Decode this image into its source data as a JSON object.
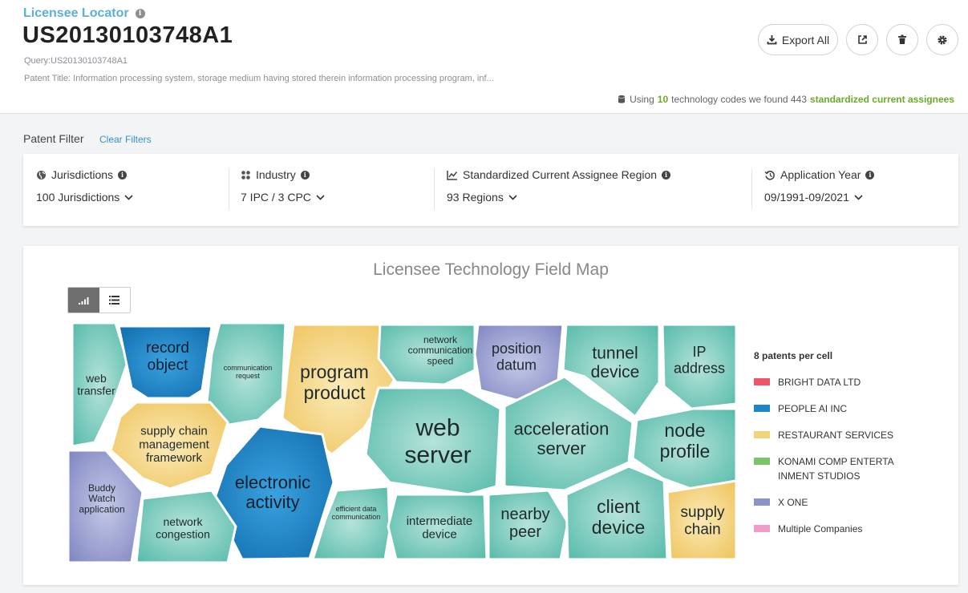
{
  "header": {
    "app_title": "Licensee Locator",
    "patent_number": "US20130103748A1",
    "query": "Query:US20130103748A1",
    "patent_title": "Patent Title: Information processing system, storage medium having stored therein information processing program, inf...",
    "export_label": "Export All",
    "summary": {
      "prefix": "Using",
      "codes": "10",
      "middle": "technology codes we found 443",
      "highlight": "standardized current assignees"
    }
  },
  "filters": {
    "label": "Patent Filter",
    "clear_label": "Clear Filters",
    "items": [
      {
        "name": "Jurisdictions",
        "value": "100 Jurisdictions"
      },
      {
        "name": "Industry",
        "value": "7 IPC / 3 CPC"
      },
      {
        "name": "Standardized Current Assignee Region",
        "value": "93 Regions"
      },
      {
        "name": "Application Year",
        "value": "09/1991-09/2021"
      }
    ]
  },
  "map": {
    "title": "Licensee Technology Field Map",
    "legend_header": "8 patents per cell",
    "legend": [
      {
        "name": "BRIGHT DATA LTD",
        "color": "#f0546a"
      },
      {
        "name": "PEOPLE AI INC",
        "color": "#1c86c8"
      },
      {
        "name": "RESTAURANT SERVICES",
        "color": "#f2d27a"
      },
      {
        "name": "KONAMI COMP ENTERTA INMENT STUDIOS",
        "color": "#7dc36a"
      },
      {
        "name": "X ONE",
        "color": "#8c93c9"
      },
      {
        "name": "Multiple Companies",
        "color": "#f29bc8"
      }
    ],
    "cells": [
      {
        "label": [
          "web",
          "transfer"
        ],
        "kind": "teal"
      },
      {
        "label": [
          "record",
          "object"
        ],
        "kind": "blue"
      },
      {
        "label": [
          "communication",
          "request"
        ],
        "kind": "teal"
      },
      {
        "label": [
          "program",
          "product"
        ],
        "kind": "yellow"
      },
      {
        "label": [
          "network",
          "communication",
          "speed"
        ],
        "kind": "teal"
      },
      {
        "label": [
          "position",
          "datum"
        ],
        "kind": "purple"
      },
      {
        "label": [
          "tunnel",
          "device"
        ],
        "kind": "teal"
      },
      {
        "label": [
          "IP",
          "address"
        ],
        "kind": "teal"
      },
      {
        "label": [
          "supply chain",
          "management",
          "framework"
        ],
        "kind": "yellow"
      },
      {
        "label": [
          "web",
          "server"
        ],
        "kind": "teal"
      },
      {
        "label": [
          "acceleration",
          "server"
        ],
        "kind": "teal"
      },
      {
        "label": [
          "node",
          "profile"
        ],
        "kind": "teal"
      },
      {
        "label": [
          "Buddy",
          "Watch",
          "application"
        ],
        "kind": "purple"
      },
      {
        "label": [
          "electronic",
          "activity"
        ],
        "kind": "blue"
      },
      {
        "label": [
          "efficient data",
          "communication"
        ],
        "kind": "teal"
      },
      {
        "label": [
          "network",
          "congestion"
        ],
        "kind": "teal"
      },
      {
        "label": [
          "intermediate",
          "device"
        ],
        "kind": "teal"
      },
      {
        "label": [
          "nearby",
          "peer"
        ],
        "kind": "teal"
      },
      {
        "label": [
          "client",
          "device"
        ],
        "kind": "teal"
      },
      {
        "label": [
          "supply",
          "chain"
        ],
        "kind": "yellow"
      }
    ]
  }
}
